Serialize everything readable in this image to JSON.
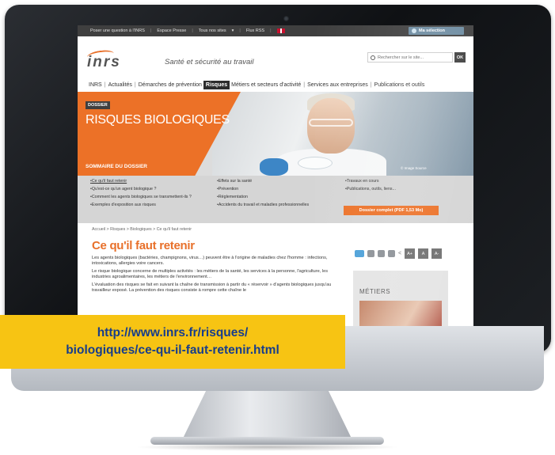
{
  "topbar": {
    "items": [
      "Poser une question à l'INRS",
      "Espace Presse",
      "Tous nos sites",
      "Flux RSS"
    ],
    "selection_label": "Ma sélection"
  },
  "header": {
    "logo": "inrs",
    "tagline": "Santé et sécurité au travail",
    "search_placeholder": "Rechercher sur le site...",
    "search_button": "OK"
  },
  "nav": {
    "items": [
      "INRS",
      "Actualités",
      "Démarches de prévention",
      "Risques",
      "Métiers et secteurs d'activité",
      "Services aux entreprises",
      "Publications et outils"
    ],
    "active": "Risques"
  },
  "banner": {
    "tag": "DOSSIER",
    "title": "RISQUES BIOLOGIQUES",
    "sommaire": "SOMMAIRE DU DOSSIER",
    "credit": "© Image Source"
  },
  "summary": {
    "col1": [
      "Ce qu'il faut retenir",
      "Qu'est-ce qu'un agent biologique ?",
      "Comment les agents biologiques se transmettent-ils ?",
      "Exemples d'exposition aux risques"
    ],
    "col2": [
      "Effets sur la santé",
      "Prévention",
      "Réglementation",
      "Accidents du travail et maladies professionnelles"
    ],
    "col3": [
      "Travaux en cours",
      "Publications, outils, liens..."
    ],
    "pdf_button": "Dossier complet (PDF 1,53 Mo)"
  },
  "breadcrumb": "Accueil > Risques > Biologiques > Ce qu'il faut retenir",
  "article": {
    "title": "Ce qu'il faut retenir",
    "paragraphs": [
      "Les agents biologiques (bactéries, champignons, virus…) peuvent être à l'origine de maladies chez l'homme : infections, intoxications, allergies voire cancers.",
      "Le risque biologique concerne de multiples activités : les métiers de la santé, les services à la personne, l'agriculture, les industries agroalimentaires, les métiers de l'environnement…",
      "L'évaluation des risques se fait en suivant la chaîne de transmission à partir du « réservoir » d'agents biologiques jusqu'au travailleur exposé. La prévention des risques consiste à rompre cette chaîne le"
    ]
  },
  "font_buttons": [
    "A+",
    "A",
    "A-"
  ],
  "metiers_label": "MÉTIERS",
  "url_banner": {
    "line1": "http://www.inrs.fr/risques/",
    "line2": "biologiques/ce-qu-il-faut-retenir.html"
  },
  "colors": {
    "accent_orange": "#ec7127",
    "url_banner_bg": "#f7c413",
    "url_text": "#173d8c"
  }
}
